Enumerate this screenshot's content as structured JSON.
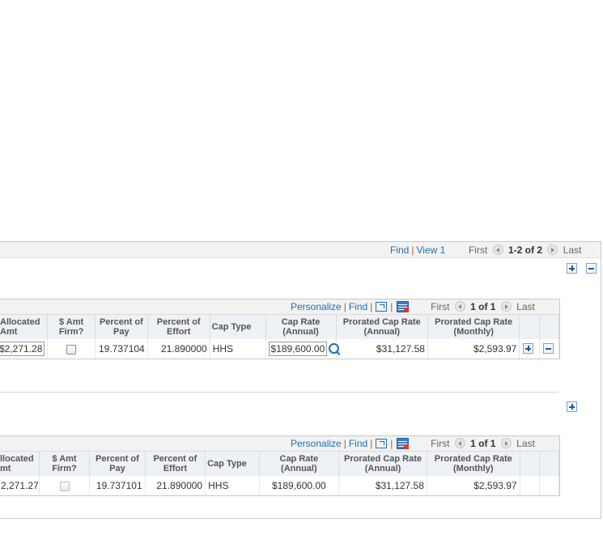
{
  "outer_nav": {
    "find": "Find",
    "view": "View 1",
    "first": "First",
    "count": "1-2 of 2",
    "last": "Last"
  },
  "grid_nav": {
    "personalize": "Personalize",
    "find": "Find",
    "first": "First",
    "count": "1 of 1",
    "last": "Last"
  },
  "headers": [
    "Allocated Amt",
    "$ Amt Firm?",
    "Percent of Pay",
    "Percent of Effort",
    "Cap Type",
    "Cap Rate (Annual)",
    "Prorated Cap Rate (Annual)",
    "Prorated Cap Rate (Monthly)"
  ],
  "header_lines": {
    "alloc": [
      "Allocated",
      "Amt"
    ],
    "firm": [
      "$ Amt",
      "Firm?"
    ],
    "pay": [
      "Percent of",
      "Pay"
    ],
    "effort": [
      "Percent of",
      "Effort"
    ],
    "captype": "Cap Type",
    "caprate": [
      "Cap Rate",
      "(Annual)"
    ],
    "pannual": [
      "Prorated Cap Rate",
      "(Annual)"
    ],
    "pmonthly": [
      "Prorated Cap Rate",
      "(Monthly)"
    ]
  },
  "row1": {
    "alloc": "$2,271.28",
    "pay": "19.737104",
    "effort": "21.890000",
    "captype": "HHS",
    "caprate": "$189,600.00",
    "pannual": "$31,127.58",
    "pmonthly": "$2,593.97"
  },
  "row2": {
    "alloc": "2,271.27",
    "pay": "19.737101",
    "effort": "21.890000",
    "captype": "HHS",
    "caprate": "$189,600.00",
    "pannual": "$31,127.58",
    "pmonthly": "$2,593.97"
  },
  "row2_alloc_prefix": "$",
  "header2_alloc": [
    "llocated",
    "mt"
  ]
}
